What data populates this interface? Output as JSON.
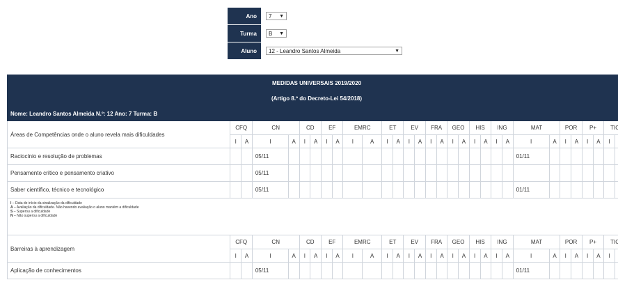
{
  "filters": {
    "ano": {
      "label": "Ano",
      "value": "7"
    },
    "turma": {
      "label": "Turma",
      "value": "B"
    },
    "aluno": {
      "label": "Aluno",
      "value": "12 - Leandro Santos Almeida"
    }
  },
  "header": {
    "title": "MEDIDAS UNIVERSAIS 2019/2020",
    "subtitle": "(Artigo 8.º do Decreto-Lei 54/2018)",
    "student_line": "Nome: Leandro Santos Almeida   N.º: 12   Ano: 7   Turma: B"
  },
  "subjects": [
    "CFQ",
    "CN",
    "CD",
    "EF",
    "EMRC",
    "ET",
    "EV",
    "FRA",
    "GEO",
    "HIS",
    "ING",
    "MAT",
    "POR",
    "P+",
    "TIC"
  ],
  "sub_i": "I",
  "sub_a": "A",
  "section1": {
    "title": "Áreas de Competências onde o aluno revela mais dificuldades",
    "rows": [
      {
        "label": "Raciocínio e resolução de problemas",
        "cn": "05/11",
        "mat": "01/11"
      },
      {
        "label": "Pensamento crítico e pensamento criativo",
        "cn": "05/11",
        "mat": ""
      },
      {
        "label": "Saber científico, técnico e tecnológico",
        "cn": "05/11",
        "mat": "01/11"
      }
    ]
  },
  "legend": [
    {
      "key": "I",
      "text": " – Data de início da sinalização da dificuldade"
    },
    {
      "key": "A",
      "text": " – Avaliação da dificuldade. Não havendo avaliação o aluno mantém a dificuldade"
    },
    {
      "key": "S",
      "text": " – Superou a dificuldade"
    },
    {
      "key": "N",
      "text": " – Não superou a dificuldade"
    }
  ],
  "section2": {
    "title": "Barreiras à aprendizagem",
    "rows": [
      {
        "label": "Aplicação de conhecimentos",
        "cn": "05/11",
        "mat": "01/11"
      }
    ]
  },
  "colors": {
    "header_bg": "#1f3350",
    "border": "#d0d5dc"
  }
}
